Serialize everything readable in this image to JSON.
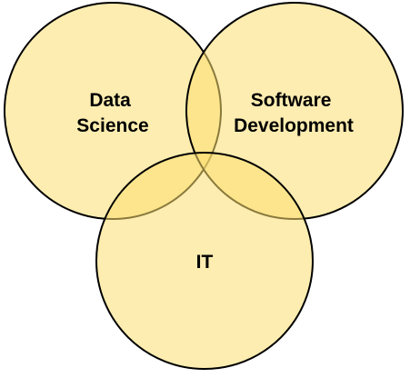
{
  "diagram": {
    "type": "venn",
    "colors": {
      "fill": "#fbdf6f",
      "fill_opacity": 0.55,
      "stroke": "#000000"
    },
    "sets": [
      {
        "id": "data-science",
        "label_lines": [
          "Data",
          "Science"
        ]
      },
      {
        "id": "software-development",
        "label_lines": [
          "Software",
          "Development"
        ]
      },
      {
        "id": "it",
        "label_lines": [
          "IT"
        ]
      }
    ]
  }
}
